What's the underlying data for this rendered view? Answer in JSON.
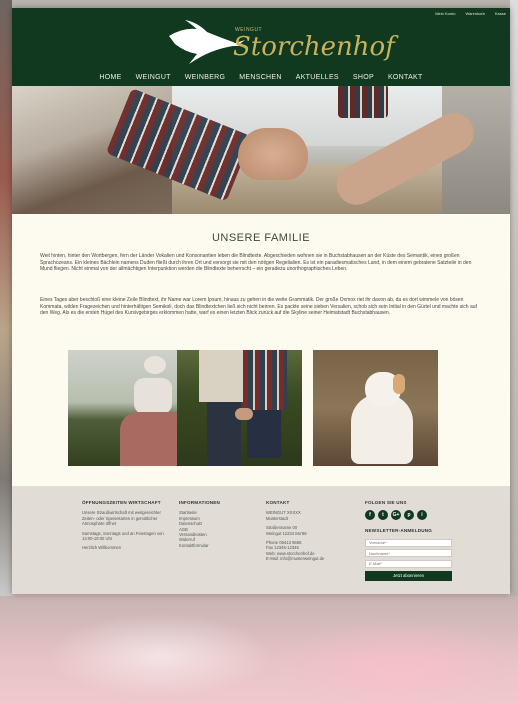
{
  "top_links": [
    "Mein Konto",
    "Warenkorb",
    "Kasse"
  ],
  "logo": {
    "sub": "WEINGUT",
    "name": "Storchenhof"
  },
  "nav": [
    "HOME",
    "WEINGUT",
    "WEINBERG",
    "MENSCHEN",
    "AKTUELLES",
    "SHOP",
    "KONTAKT"
  ],
  "main": {
    "title": "UNSERE FAMILIE",
    "paragraphs": [
      "Weit hinten, hinter den Wortbergen, fern der Länder Vokalien und Konsonantien leben die Blindtexte. Abgeschieden wohnen sie in Buchstabhausen an der Küste des Semantik, eines großen Sprachozeans. Ein kleines Bächlein namens Duden fließt durch ihren Ort und versorgt sie mit den nötigen Regelialien. Es ist ein paradiesmatisches Land, in dem einem gebratene Satzteile in den Mund fliegen. Nicht einmal von der allmächtigen Interpunktion werden die Blindtexte beherrscht – ein geradezu unorthographisches Leben.",
      "Eines Tages aber beschloß eine kleine Zeile Blindtext, ihr Name war Lorem Ipsum, hinaus zu gehen in die weite Grammatik. Der große Oxmox riet ihr davon ab, da es dort wimmele von bösen Kommata, wilden Fragezeichen und hinterhältigen Semikoli, doch das Blindtextchen ließ sich nicht beirren. Es packte seine sieben Versalien, schob sich sein Initial in den Gürtel und machte sich auf den Weg. Als es die ersten Hügel des Kursivgebirges erklommen hatte, warf es einen letzten Blick zurück auf die Skyline seiner Heimatstadt Buchstabhausen."
    ]
  },
  "footer": {
    "col1": {
      "heading": "ÖFFNUNGSZEITEN WIRTSCHAFT",
      "lines": [
        "Unsere Straußwirtschaft mit weitgereichter Zeiten- oder Speisekarten in gemütlicher Atmosphäre öffnet",
        "Samstags, Sonntags und an Feiertagen von 14:00-18:00 Uhr",
        "Herzlich Willkommen"
      ]
    },
    "col2": {
      "heading": "INFORMATIONEN",
      "links": [
        "Startseite",
        "Impressum",
        "Datenschutz",
        "AGB",
        "Versandkosten",
        "Widerruf",
        "Kontaktformular"
      ]
    },
    "col3": {
      "heading": "KONTAKT",
      "address": [
        "WEINGUT XXXXX",
        "Musterstadt",
        "Straßenname 00",
        "Weingut 12234 Mo'88"
      ],
      "contact": [
        "Phone 06413 6666",
        "Fax 12345-12345",
        "Web: www.storchenhof.de",
        "E-Mail: info@musterweingut.de"
      ]
    },
    "col4": {
      "follow_heading": "FOLGEN SIE UNS",
      "social": [
        "f",
        "t",
        "G+",
        "p",
        "i"
      ],
      "newsletter_heading": "NEWSLETTER-ANMELDUNG",
      "fields": [
        "Vorname*",
        "Nachname*",
        "E-Mail*"
      ],
      "button": "Jetzt abonnieren"
    }
  },
  "colors": {
    "header_green": "#10391f",
    "accent_gold": "#c9b25b",
    "page_bg": "#fdfbef",
    "footer_bg": "#e1ddd6"
  }
}
